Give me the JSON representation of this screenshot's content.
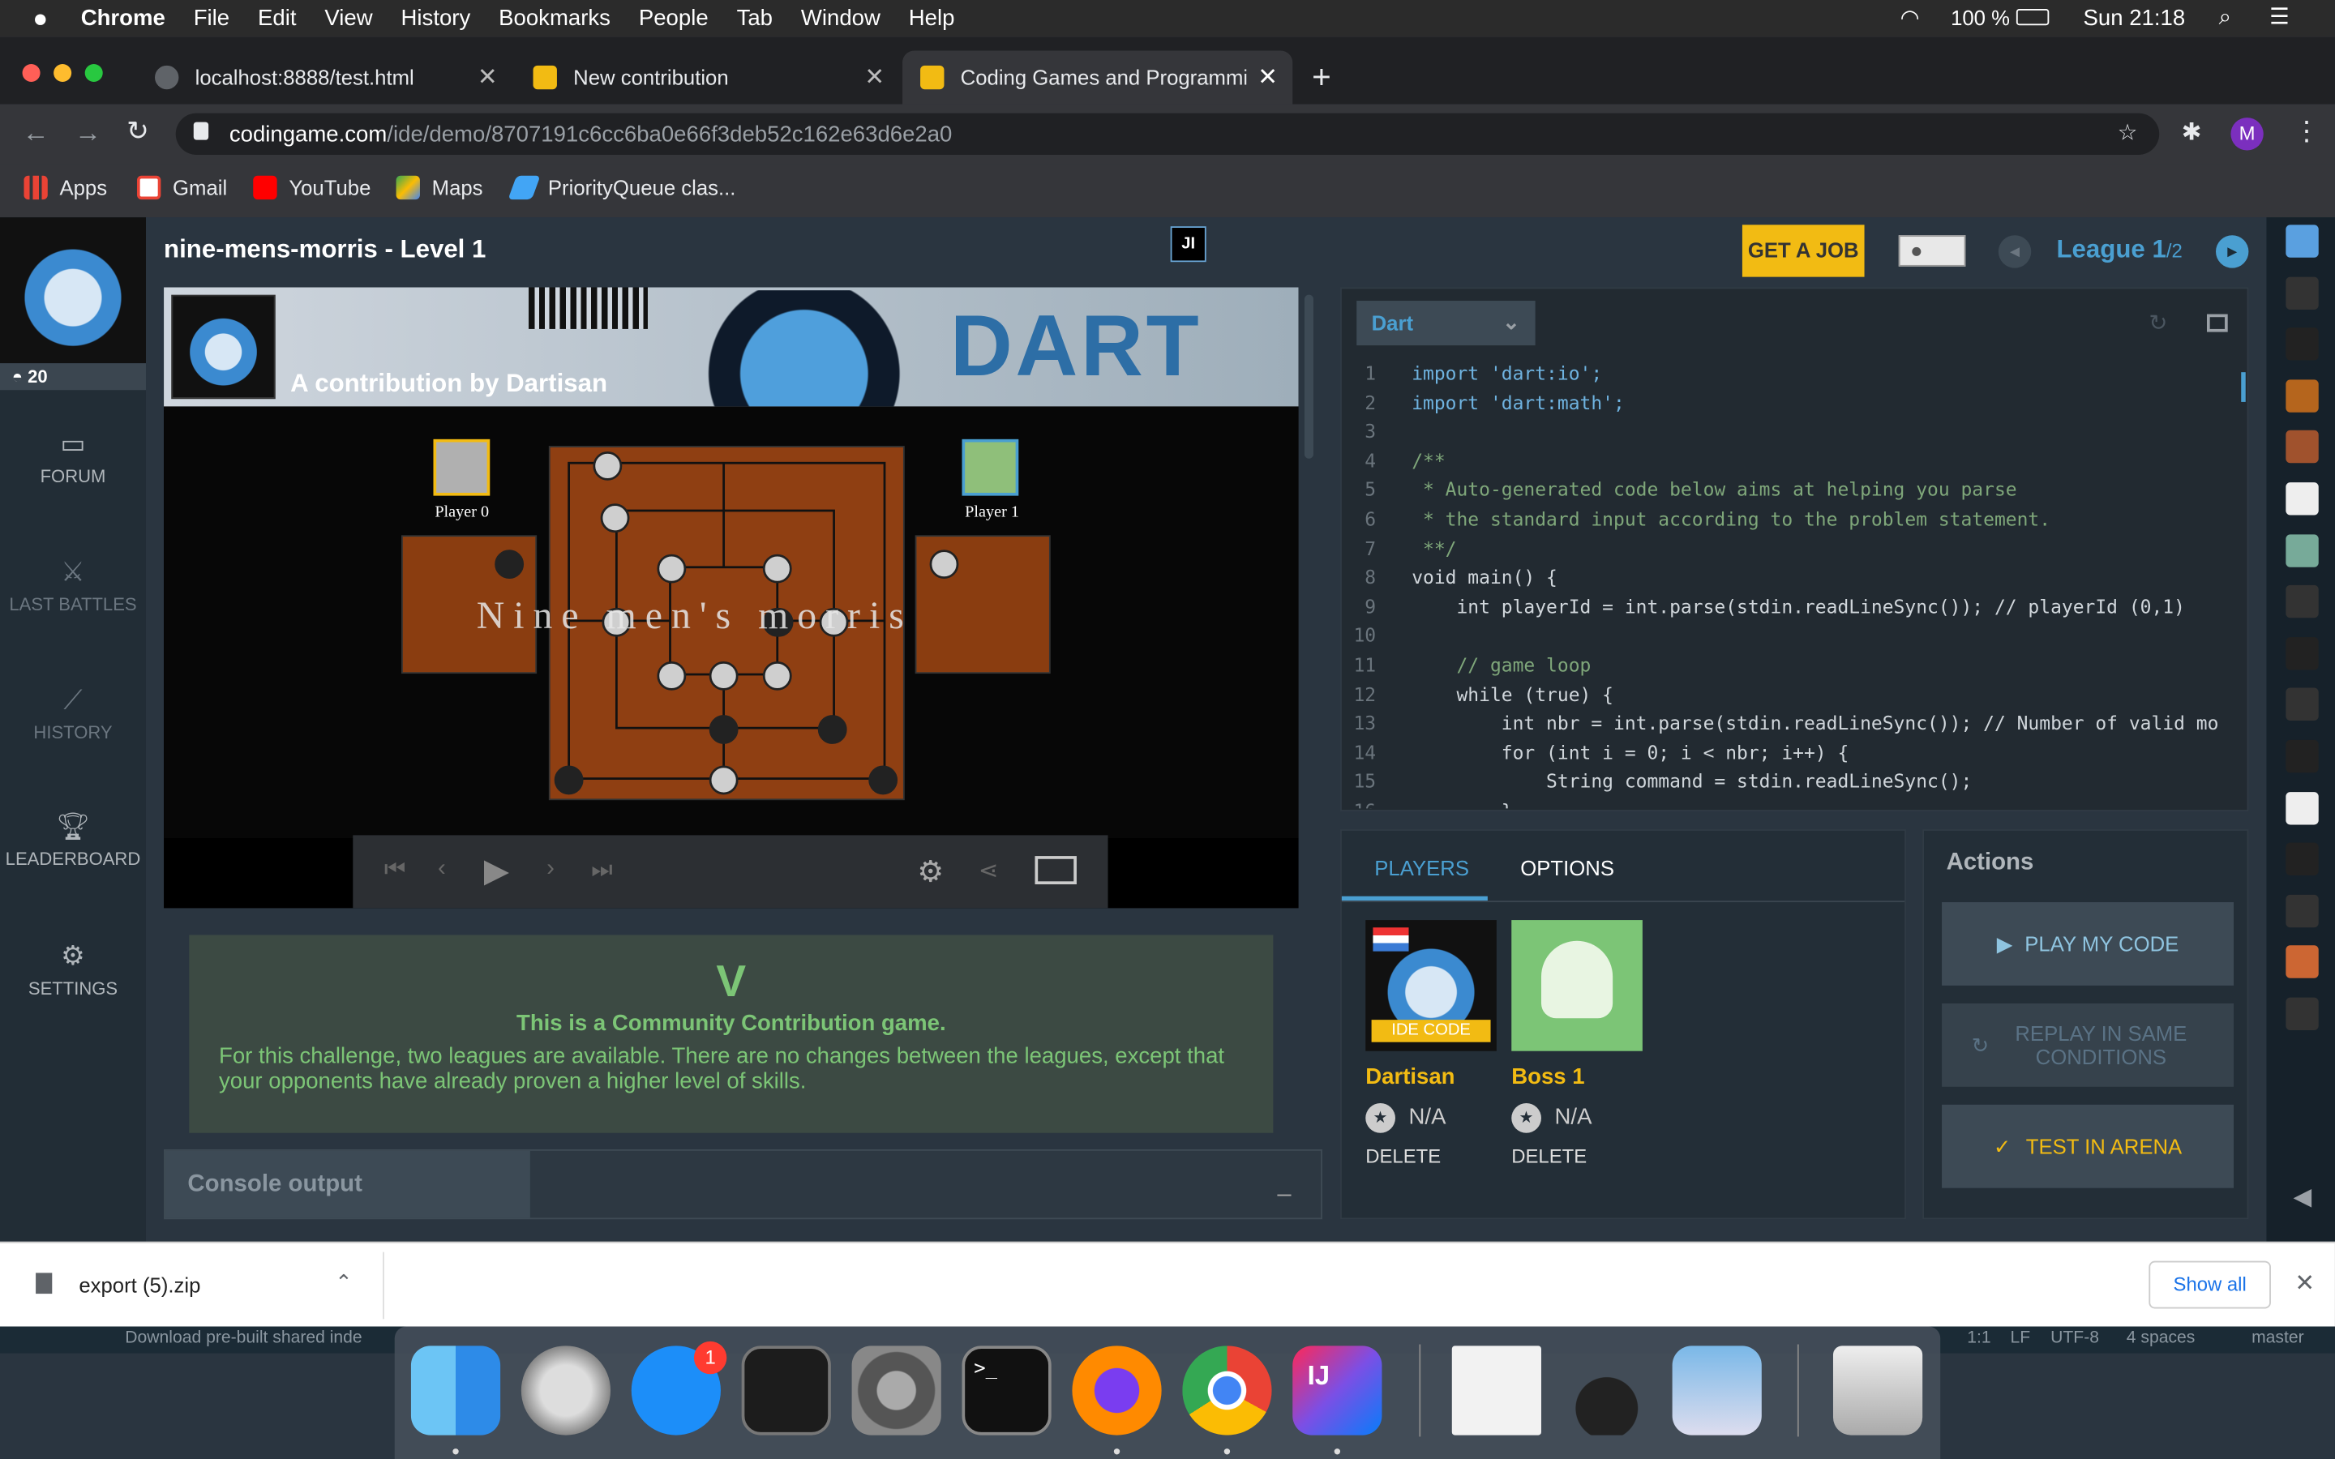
{
  "menubar": {
    "app": "Chrome",
    "items": [
      "File",
      "Edit",
      "View",
      "History",
      "Bookmarks",
      "People",
      "Tab",
      "Window",
      "Help"
    ],
    "battery": "100 %",
    "clock": "Sun 21:18"
  },
  "tabs": [
    {
      "title": "localhost:8888/test.html"
    },
    {
      "title": "New contribution"
    },
    {
      "title": "Coding Games and Programmin"
    }
  ],
  "address": {
    "domain": "codingame.com",
    "path": "/ide/demo/8707191c6cc6ba0e66f3deb52c162e63d6e2a0"
  },
  "bookmarks": [
    "Apps",
    "Gmail",
    "YouTube",
    "Maps",
    "PriorityQueue clas..."
  ],
  "sidebar": {
    "rank": "20",
    "items": [
      "FORUM",
      "LAST BATTLES",
      "HISTORY",
      "LEADERBOARD",
      "SETTINGS"
    ]
  },
  "header": {
    "title": "nine-mens-morris - Level 1",
    "get_job": "GET A JOB",
    "league": "League 1",
    "league_total": "/2"
  },
  "viewer": {
    "contribution": "A contribution by Dartisan",
    "banner_text": "DART",
    "game_title": "Nine men's morris",
    "player0": "Player 0",
    "player1": "Player 1"
  },
  "community": {
    "heading": "This is a Community Contribution game.",
    "body": "For this challenge, two leagues are available. There are no changes between the leagues, except that your opponents have already proven a higher level of skills."
  },
  "console": {
    "label": "Console output",
    "minimize": "_"
  },
  "editor": {
    "language": "Dart",
    "lines": [
      {
        "n": "1",
        "text": "import 'dart:io';"
      },
      {
        "n": "2",
        "text": "import 'dart:math';"
      },
      {
        "n": "3",
        "text": ""
      },
      {
        "n": "4",
        "text": "/**"
      },
      {
        "n": "5",
        "text": " * Auto-generated code below aims at helping you parse"
      },
      {
        "n": "6",
        "text": " * the standard input according to the problem statement."
      },
      {
        "n": "7",
        "text": " **/"
      },
      {
        "n": "8",
        "text": "void main() {"
      },
      {
        "n": "9",
        "text": "    int playerId = int.parse(stdin.readLineSync()); // playerId (0,1)"
      },
      {
        "n": "10",
        "text": ""
      },
      {
        "n": "11",
        "text": "    // game loop"
      },
      {
        "n": "12",
        "text": "    while (true) {"
      },
      {
        "n": "13",
        "text": "        int nbr = int.parse(stdin.readLineSync()); // Number of valid mo"
      },
      {
        "n": "14",
        "text": "        for (int i = 0; i < nbr; i++) {"
      },
      {
        "n": "15",
        "text": "            String command = stdin.readLineSync();"
      },
      {
        "n": "16",
        "text": "        }"
      }
    ]
  },
  "players": {
    "tabs": [
      "PLAYERS",
      "OPTIONS"
    ],
    "list": [
      {
        "name": "Dartisan",
        "badge": "IDE CODE",
        "rank": "N/A",
        "delete": "DELETE"
      },
      {
        "name": "Boss 1",
        "rank": "N/A",
        "delete": "DELETE"
      }
    ]
  },
  "actions": {
    "title": "Actions",
    "play": "PLAY MY CODE",
    "replay": "REPLAY IN SAME CONDITIONS",
    "test": "TEST IN ARENA"
  },
  "download": {
    "file": "export (5).zip",
    "show_all": "Show all"
  },
  "ide_status": {
    "left": "Download pre-built shared inde",
    "right": [
      "1:1",
      "LF",
      "UTF-8",
      "4 spaces",
      "master"
    ]
  },
  "dock": {
    "badge": "1"
  },
  "colors": {
    "accent": "#f2bb13",
    "cg_blue": "#4a9fd1",
    "green": "#7cc576"
  }
}
